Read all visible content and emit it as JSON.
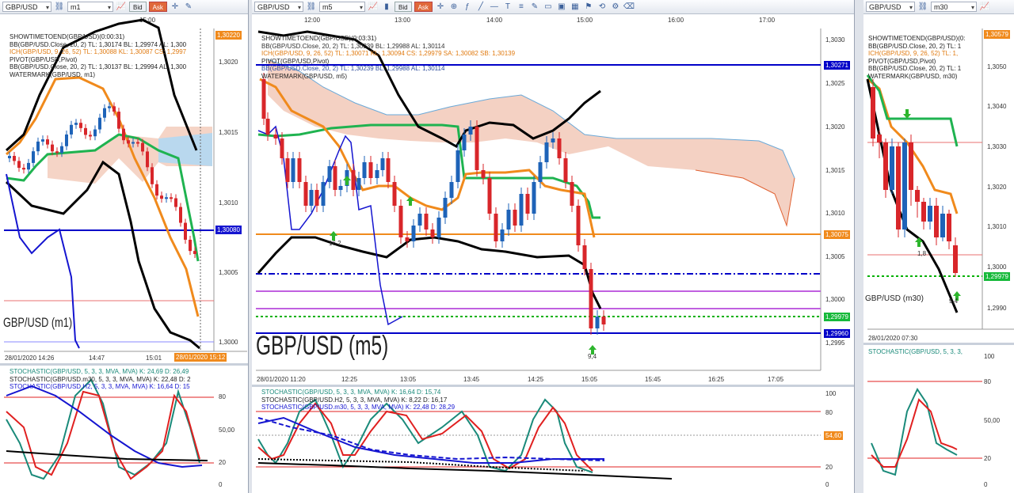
{
  "colors": {
    "black": "#000000",
    "orange": "#f08a1c",
    "green": "#1fb350",
    "blue": "#1515d0",
    "red": "#e02020",
    "teal": "#1a8a7a",
    "cloud": "#f2c9b8",
    "bull": "#1e63b8",
    "bear": "#d8262a",
    "hline_blue": "#0000c8"
  },
  "left": {
    "symbol": "GBP/USD",
    "timeframe": "m1",
    "bid": "Bid",
    "ask": "Ask",
    "time_top": "15:00",
    "legend": [
      "SHOWTIMETOEND(GBP/USD)(0:00:31)",
      "BB(GBP/USD.Close, 20, 2)  TL: 1,30174  BL: 1,29974  AL: 1,300",
      "ICH(GBP/USD, 9, 26, 52)  TL: 1,30088  KL: 1,30087  CS: 1,2997",
      "PIVOT(GBP/USD,Pivot)",
      "BB(GBP/USD.Close, 20, 2)  TL: 1,30137  BL: 1,29994  AL: 1,300",
      "WATERMARK(GBP/USD, m1)"
    ],
    "prices": [
      "1,3020",
      "1,3015",
      "1,3010",
      "1,3005",
      "1,3000"
    ],
    "tag_top": "1,30220",
    "tag_mid": "1,30080",
    "watermark": "GBP/USD (m1)",
    "times": [
      "28/01/2020 14:26",
      "14:47",
      "15:01"
    ],
    "time_tag": "28/01/2020 15:12",
    "stoch_legend": [
      "STOCHASTIC(GBP/USD, 5, 3, 3, MVA, MVA)  K: 24,69  D: 26,49",
      "STOCHASTIC(GBP/USD.m30, 5, 3, 3, MVA, MVA)  K: 22,48  D: 2",
      "STOCHASTIC(GBP/USD.H2, 5, 3, 3, MVA, MVA)  K: 16,64  D: 15"
    ],
    "stoch_levels": [
      "80",
      "50,00",
      "20",
      "0"
    ]
  },
  "mid": {
    "symbol": "GBP/USD",
    "timeframe": "m5",
    "bid": "Bid",
    "ask": "Ask",
    "times_top": [
      "12:00",
      "13:00",
      "14:00",
      "15:00",
      "16:00",
      "17:00"
    ],
    "legend": [
      "SHOWTIMETOEND(GBP/USD)(0:03:31)",
      "BB(GBP/USD.Close, 20, 2)  TL: 1,30239  BL: 1,29988  AL: 1,30114",
      "ICH(GBP/USD, 9, 26, 52)  TL: 1,30071  KL: 1,30094  CS: 1,29979  SA: 1,30082  SB: 1,30139",
      "PIVOT(GBP/USD,Pivot)",
      "BB(GBP/USD.Close, 20, 2)  TL: 1,30239  BL: 1,29988  AL: 1,30114",
      "WATERMARK(GBP/USD, m5)"
    ],
    "prices": [
      "1,3030",
      "1,3025",
      "1,3020",
      "1,3015",
      "1,3010",
      "1,3005",
      "1,3000",
      "1,2995"
    ],
    "tag_blue": "1,30271",
    "tag_orange": "1,30075",
    "tag_green": "1,29979",
    "tag_low": "1,29960",
    "watermark": "GBP/USD (m5)",
    "marker1": "16,2",
    "marker2": "9,4",
    "times_bottom": [
      "28/01/2020 11:20",
      "12:25",
      "13:05",
      "13:45",
      "14:25",
      "15:05",
      "15:45",
      "16:25",
      "17:05"
    ],
    "stoch_legend": [
      "STOCHASTIC(GBP/USD, 5, 3, 3, MVA, MVA)  K: 16,64  D: 15,74",
      "STOCHASTIC(GBP/USD.H2, 5, 3, 3, MVA, MVA)  K: 8,22  D: 16,17",
      "STOCHASTIC(GBP/USD.m30, 5, 3, 3, MVA, MVA)  K: 22,48  D: 28,29"
    ],
    "stoch_levels": [
      "100",
      "80",
      "20",
      "0"
    ],
    "stoch_tag": "54,60"
  },
  "right": {
    "symbol": "GBP/USD",
    "timeframe": "m30",
    "legend": [
      "SHOWTIMETOEND(GBP/USD)(0:",
      "BB(GBP/USD.Close, 20, 2)  TL: 1",
      "ICH(GBP/USD, 9, 26, 52)  TL: 1,",
      "PIVOT(GBP/USD,Pivot)",
      "BB(GBP/USD.Close, 20, 2)  TL: 1",
      "WATERMARK(GBP/USD, m30)"
    ],
    "prices": [
      "1,3050",
      "1,3040",
      "1,3030",
      "1,3020",
      "1,3010",
      "1,3000",
      "1,2990"
    ],
    "tag_top": "1,30579",
    "tag_green": "1,29979",
    "marker": "1,8",
    "marker2": "9,4",
    "watermark": "GBP/USD (m30)",
    "time": "28/01/2020 07:30",
    "stoch_legend": [
      "STOCHASTIC(GBP/USD, 5, 3, 3,"
    ],
    "stoch_levels": [
      "100",
      "80",
      "50,00",
      "20",
      "0"
    ]
  }
}
